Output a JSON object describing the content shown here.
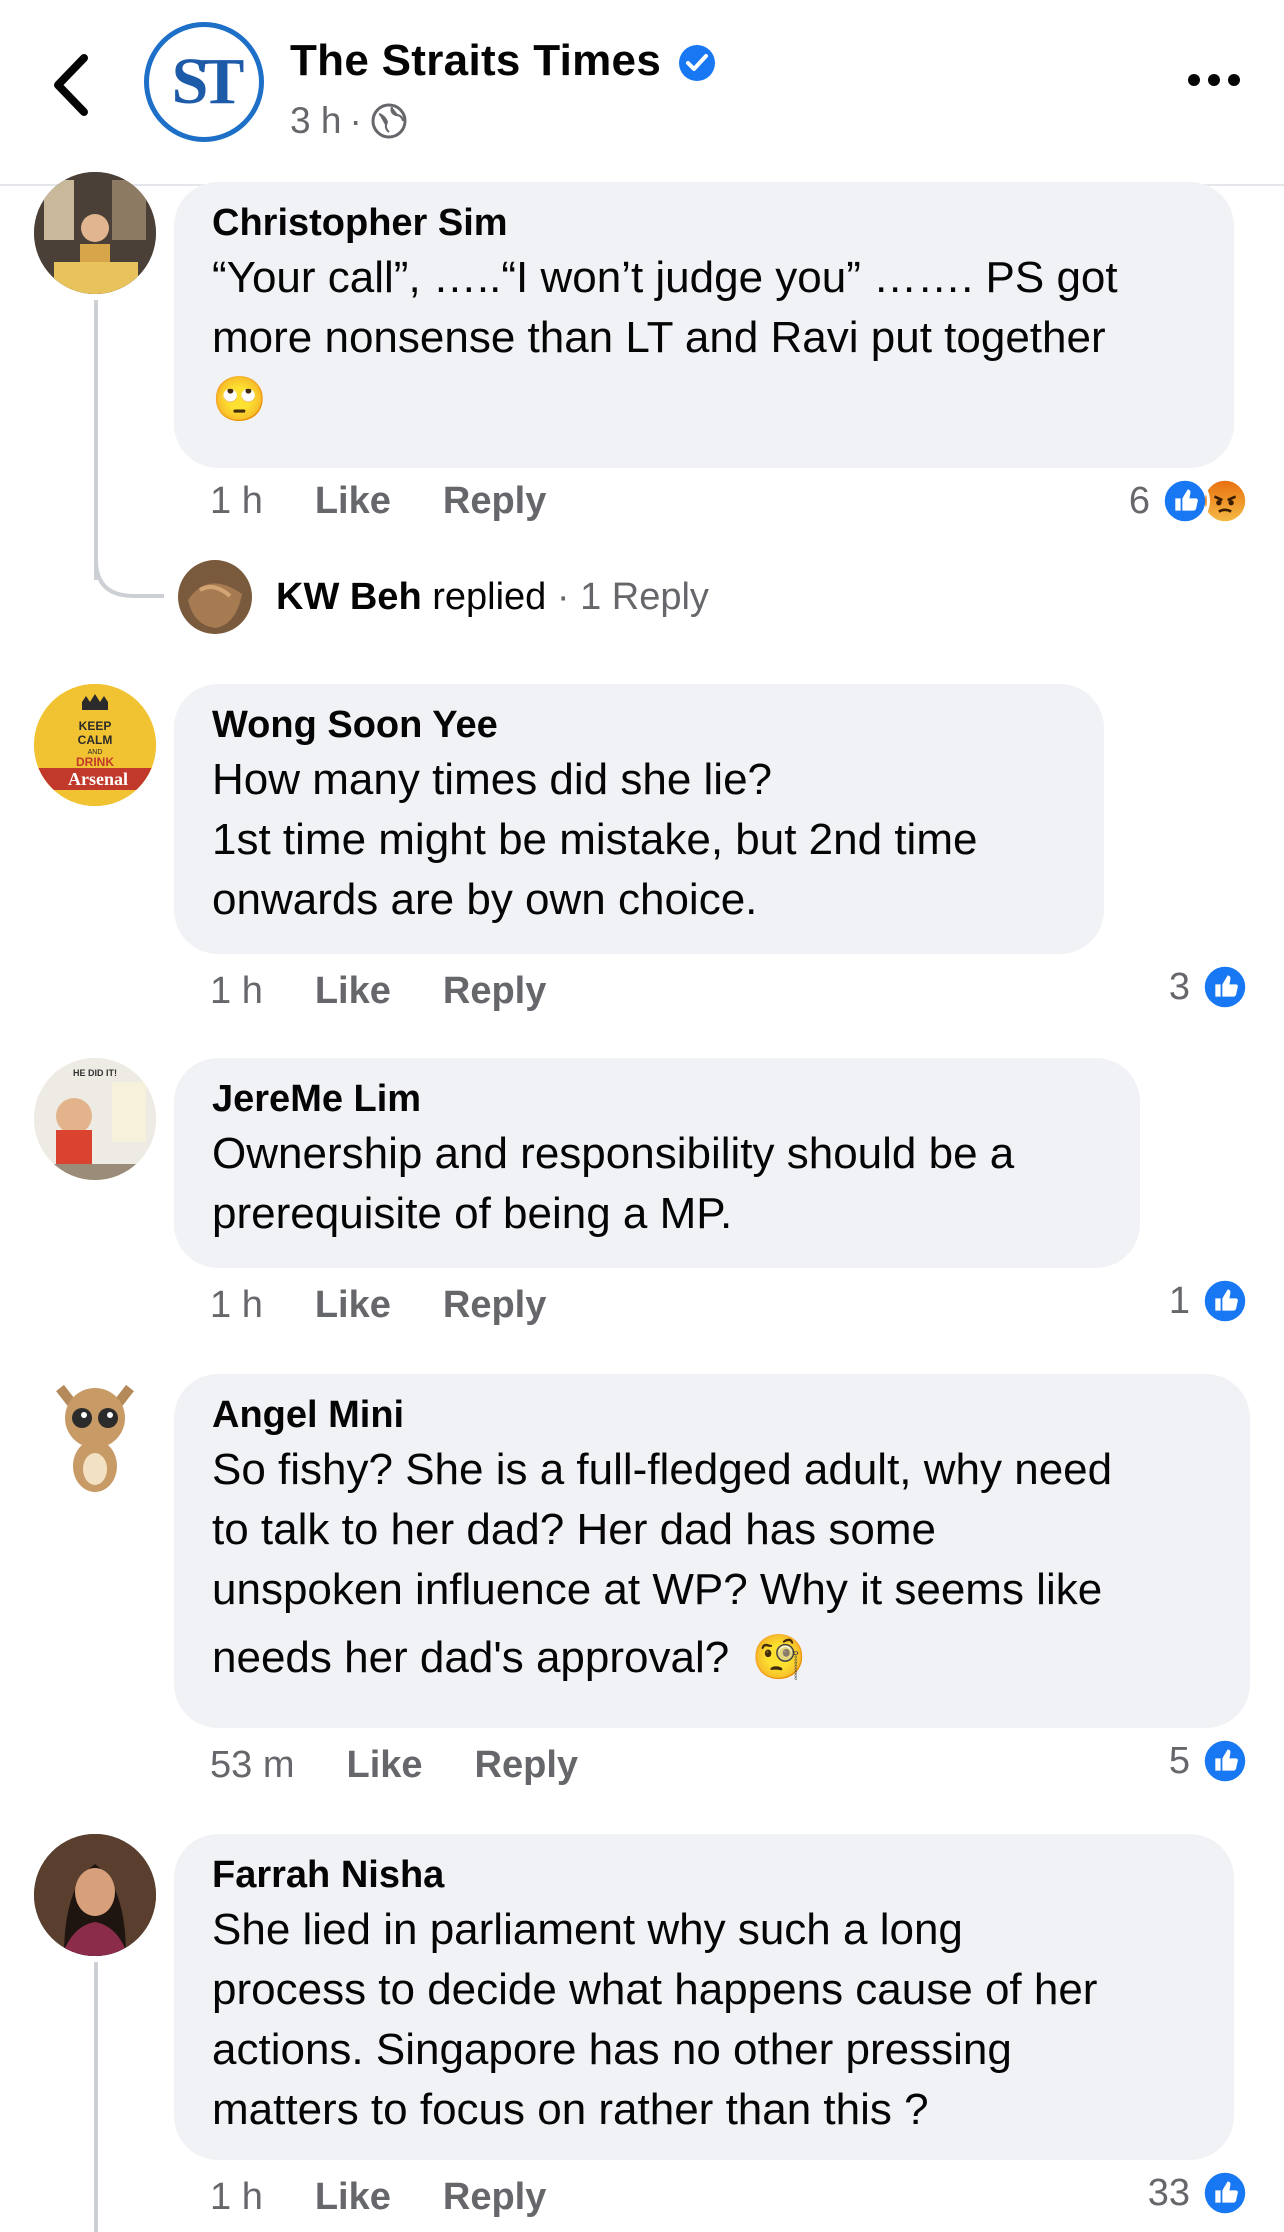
{
  "header": {
    "page_logo_text": "ST",
    "page_name": "The Straits Times",
    "posted_time": "3 h",
    "dot": "·"
  },
  "comments": [
    {
      "author": "Christopher Sim",
      "lines": [
        "“Your call”, …..“I won’t judge you” ……. PS got",
        "more nonsense than LT and Ravi put together"
      ],
      "emoji": "🙄",
      "time": "1 h",
      "like": "Like",
      "reply": "Reply",
      "reaction_count": "6",
      "reactions": [
        "like-icon",
        "angry-icon"
      ],
      "replies": {
        "name": "KW Beh",
        "verb": "replied",
        "dot": "·",
        "count_label": "1 Reply"
      }
    },
    {
      "author": "Wong Soon Yee",
      "lines": [
        "How many times did she lie?",
        "1st time might be mistake, but 2nd time",
        "onwards are by own choice."
      ],
      "time": "1 h",
      "like": "Like",
      "reply": "Reply",
      "reaction_count": "3",
      "avatar_text": [
        "KEEP",
        "CALM",
        "AND",
        "DRINK",
        "Arsenal"
      ]
    },
    {
      "author": "JereMe Lim",
      "lines": [
        "Ownership and responsibility should be a",
        "prerequisite of being a MP."
      ],
      "time": "1 h",
      "like": "Like",
      "reply": "Reply",
      "reaction_count": "1",
      "avatar_text": "HE DID IT!"
    },
    {
      "author": "Angel Mini",
      "lines": [
        "So fishy? She is a full-fledged adult, why need",
        "to talk to her dad? Her dad has some",
        "unspoken influence at WP?  Why it seems like",
        "needs her dad's approval?"
      ],
      "emoji": "🧐",
      "time": "53 m",
      "like": "Like",
      "reply": "Reply",
      "reaction_count": "5"
    },
    {
      "author": "Farrah Nisha",
      "lines": [
        "She lied in parliament why such a long",
        "process to decide what happens cause of her",
        "actions. Singapore has no other pressing",
        "matters to focus on rather than this ?"
      ],
      "time": "1 h",
      "like": "Like",
      "reply": "Reply",
      "reaction_count": "33"
    }
  ],
  "colors": {
    "like_blue": "#1877f2",
    "angry_orange": "#f7714b",
    "bubble_bg": "#f0f2f5",
    "muted_text": "#65676b",
    "brand_blue": "#1d5aa8"
  }
}
